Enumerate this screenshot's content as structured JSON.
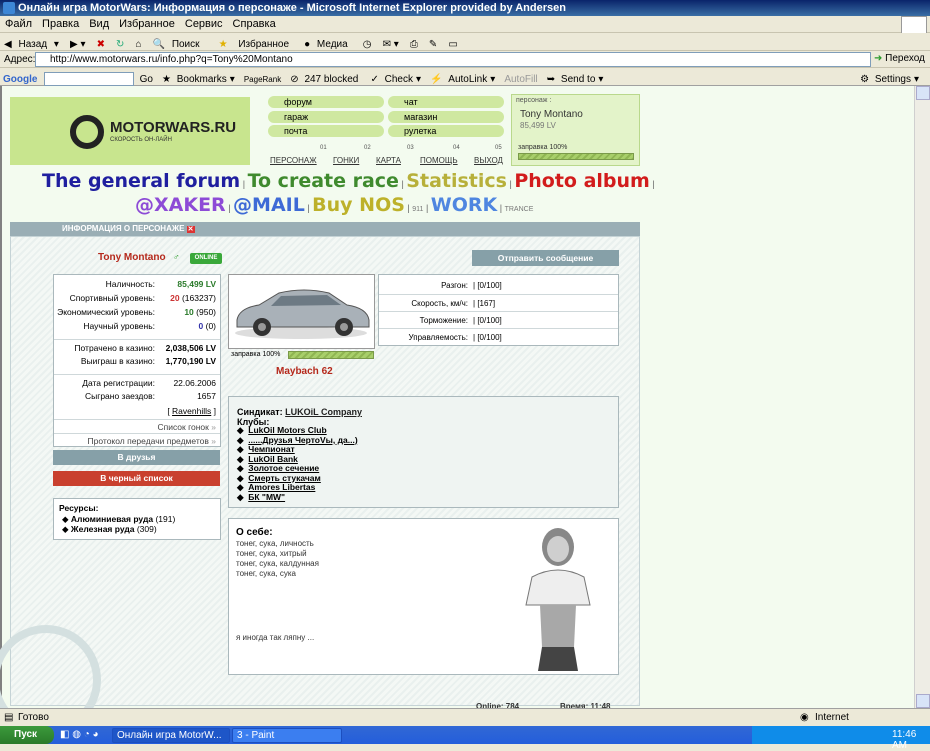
{
  "window": {
    "title": "Онлайн игра MotorWars: Информация о персонаже - Microsoft Internet Explorer provided by Andersen"
  },
  "menu": [
    "Файл",
    "Правка",
    "Вид",
    "Избранное",
    "Сервис",
    "Справка"
  ],
  "toolbar": {
    "back": "Назад",
    "search": "Поиск",
    "favorites": "Избранное",
    "media": "Медиа"
  },
  "address": {
    "label": "Адрес:",
    "url": "http://www.motorwars.ru/info.php?q=Tony%20Montano",
    "go": "Переход"
  },
  "google": {
    "brand": "Google",
    "go": "Go",
    "bookmarks": "Bookmarks",
    "pagerank": "PageRank",
    "blocked": "247 blocked",
    "check": "Check",
    "autolink": "AutoLink",
    "autofill": "AutoFill",
    "sendto": "Send to",
    "settings": "Settings"
  },
  "site": {
    "logo_text": "MOTORWARS.RU",
    "logo_sub": "СКОРОСТЬ ОН-ЛАЙН",
    "nav": {
      "forum": "форум",
      "chat": "чат",
      "garage": "гараж",
      "shop": "магазин",
      "mail": "почта",
      "roulette": "рулетка"
    },
    "bottom_nav": [
      "ПЕРСОНАЖ",
      "ГОНКИ",
      "КАРТА",
      "ПОМОЩЬ",
      "ВЫХОД"
    ],
    "nav_numbers": [
      "01",
      "02",
      "03",
      "04",
      "05"
    ],
    "character_box": {
      "label": "персонаж :",
      "name": "Tony Montano",
      "cash": "85,499 LV",
      "fuel": "заправка 100%"
    },
    "links_row1": [
      "The general forum",
      "To create race",
      "Statistics",
      "Photo album"
    ],
    "links_row2": [
      "@XAKER",
      "@MAIL",
      "Buy NOS",
      "911",
      "WORK",
      "TRANCE"
    ],
    "info_title": "ИНФОРМАЦИЯ О ПЕРСОНАЖЕ",
    "player": {
      "name": "Tony Montano",
      "status": "ONLINE"
    },
    "send_message": "Отправить сообщение",
    "stats": [
      {
        "k": "Наличность:",
        "v": "85,499 LV"
      },
      {
        "k": "Спортивный уровень:",
        "v": "20",
        "extra": "(163237)"
      },
      {
        "k": "Экономический уровень:",
        "v": "10",
        "extra": "(950)"
      },
      {
        "k": "Научный уровень:",
        "v": "0",
        "extra": "(0)"
      },
      {
        "k": "Потрачено в казино:",
        "v": "2,038,506 LV"
      },
      {
        "k": "Выиграш в казино:",
        "v": "1,770,190 LV"
      },
      {
        "k": "Дата регистрации:",
        "v": "22.06.2006"
      },
      {
        "k": "Сыграно заездов:",
        "v": "1657"
      }
    ],
    "ravenhills": "Ravenhills",
    "race_list": "Список гонок",
    "transfer_log": "Протокол передачи предметов",
    "friends_btn": "В друзья",
    "blacklist_btn": "В черный список",
    "resources": {
      "title": "Ресурсы:",
      "items": [
        {
          "name": "Алюминиевая руда",
          "count": "(191)"
        },
        {
          "name": "Железная руда",
          "count": "(309)"
        }
      ]
    },
    "car": {
      "name": "Maybach 62",
      "fuel": "заправка 100%",
      "fuel_level": 1.0
    },
    "perf": [
      {
        "k": "Разгон:",
        "v": "[0/100]"
      },
      {
        "k": "Скорость, км/ч:",
        "v": "[167]"
      },
      {
        "k": "Торможение:",
        "v": "[0/100]"
      },
      {
        "k": "Управляемость:",
        "v": "[0/100]"
      }
    ],
    "syndicate": {
      "label": "Синдикат:",
      "name": "LUKOiL Company"
    },
    "clubs": {
      "label": "Клубы:",
      "items": [
        "LukOil Motors Club",
        "......Друзья ЧертоVы, да...)",
        "Чемпионат",
        "LukOil Bank",
        "Золотое сечение",
        "Смерть стукачам",
        "Amores Libertas",
        "БК \"MW\""
      ]
    },
    "about": {
      "title": "О себе:",
      "lines": [
        "тонег, сука, личность",
        "тонег, сука, хитрый",
        "тонег, сука, калдунная",
        "тонег, сука, сука"
      ],
      "footer": "я иногда так ляпну ..."
    },
    "bottom_status": {
      "online": "Online: 784",
      "time": "Время: 11:48"
    }
  },
  "statusbar": {
    "ready": "Готово",
    "zone": "Internet"
  },
  "taskbar": {
    "start": "Пуск",
    "items": [
      "Онлайн игра MotorW...",
      "3 - Paint"
    ],
    "clock": "11:46 AM"
  },
  "colors": {
    "link_blue": "#1f1f9f",
    "link_green": "#3f8a2e",
    "link_olive": "#b7b03a",
    "link_red": "#d21c1c",
    "link_purple": "#8d4bd6",
    "link_steel": "#5b8fc9",
    "link_mw_blue": "#3e6ad6",
    "link_nos_olive": "#bdb12a",
    "link_work_blue": "#4f86e0"
  }
}
